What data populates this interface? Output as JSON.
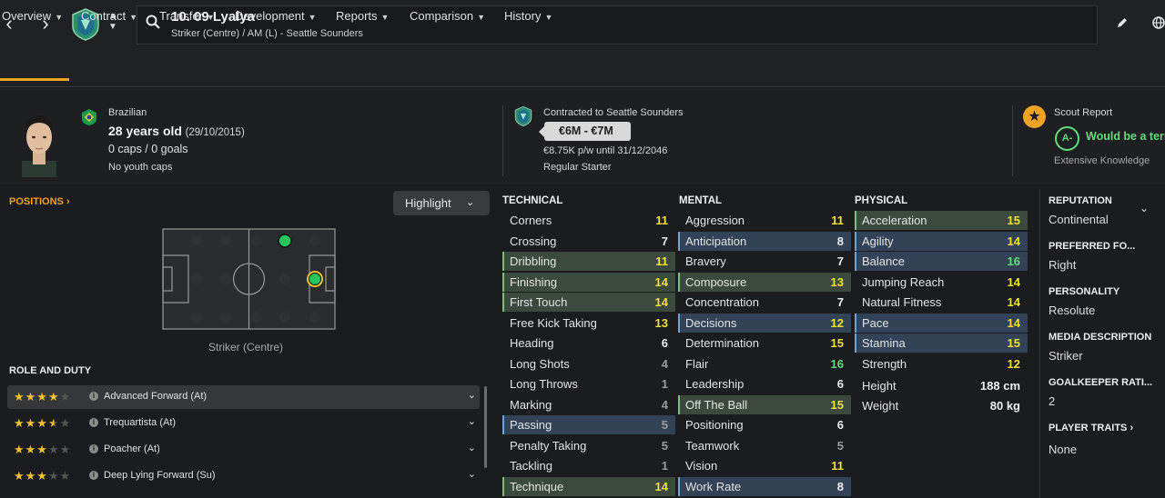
{
  "header": {
    "player_name": "10. 09 Lyalya",
    "player_subtitle": "Striker (Centre) / AM (L) - Seattle Sounders"
  },
  "tabs": [
    {
      "label": "Overview"
    },
    {
      "label": "Contract"
    },
    {
      "label": "Transfer"
    },
    {
      "label": "Development"
    },
    {
      "label": "Reports"
    },
    {
      "label": "Comparison"
    },
    {
      "label": "History"
    }
  ],
  "bio": {
    "nationality": "Brazilian",
    "age": "28 years old",
    "dob": "(29/10/2015)",
    "caps": "0 caps / 0 goals",
    "youth_caps": "No youth caps"
  },
  "contract": {
    "club_line": "Contracted to Seattle Sounders",
    "value": "€6M - €7M",
    "wage": "€8.75K p/w until 31/12/2046",
    "status": "Regular Starter"
  },
  "scout": {
    "title": "Scout Report",
    "grade": "A-",
    "summary": "Would be a terr",
    "knowledge": "Extensive Knowledge"
  },
  "positions": {
    "label": "POSITIONS",
    "highlight": "Highlight",
    "caption": "Striker (Centre)"
  },
  "roles": {
    "title": "ROLE AND DUTY",
    "items": [
      {
        "label": "Advanced Forward (At)",
        "stars": 4
      },
      {
        "label": "Trequartista (At)",
        "stars": 3.5
      },
      {
        "label": "Poacher (At)",
        "stars": 3
      },
      {
        "label": "Deep Lying Forward (Su)",
        "stars": 3
      }
    ]
  },
  "attributes": {
    "technical": {
      "title": "TECHNICAL",
      "items": [
        {
          "name": "Corners",
          "value": "11",
          "hl": "",
          "color": "yellow"
        },
        {
          "name": "Crossing",
          "value": "7",
          "hl": "",
          "color": "white"
        },
        {
          "name": "Dribbling",
          "value": "11",
          "hl": "green",
          "color": "yellow"
        },
        {
          "name": "Finishing",
          "value": "14",
          "hl": "green",
          "color": "yellow"
        },
        {
          "name": "First Touch",
          "value": "14",
          "hl": "green",
          "color": "yellow"
        },
        {
          "name": "Free Kick Taking",
          "value": "13",
          "hl": "",
          "color": "yellow"
        },
        {
          "name": "Heading",
          "value": "6",
          "hl": "",
          "color": "white"
        },
        {
          "name": "Long Shots",
          "value": "4",
          "hl": "",
          "color": "grey"
        },
        {
          "name": "Long Throws",
          "value": "1",
          "hl": "",
          "color": "grey"
        },
        {
          "name": "Marking",
          "value": "4",
          "hl": "",
          "color": "grey"
        },
        {
          "name": "Passing",
          "value": "5",
          "hl": "blue",
          "color": "grey"
        },
        {
          "name": "Penalty Taking",
          "value": "5",
          "hl": "",
          "color": "grey"
        },
        {
          "name": "Tackling",
          "value": "1",
          "hl": "",
          "color": "grey"
        },
        {
          "name": "Technique",
          "value": "14",
          "hl": "green",
          "color": "yellow"
        }
      ]
    },
    "mental": {
      "title": "MENTAL",
      "items": [
        {
          "name": "Aggression",
          "value": "11",
          "hl": "",
          "color": "yellow"
        },
        {
          "name": "Anticipation",
          "value": "8",
          "hl": "blue",
          "color": "white"
        },
        {
          "name": "Bravery",
          "value": "7",
          "hl": "",
          "color": "white"
        },
        {
          "name": "Composure",
          "value": "13",
          "hl": "green",
          "color": "yellow"
        },
        {
          "name": "Concentration",
          "value": "7",
          "hl": "",
          "color": "white"
        },
        {
          "name": "Decisions",
          "value": "12",
          "hl": "blue",
          "color": "yellow"
        },
        {
          "name": "Determination",
          "value": "15",
          "hl": "",
          "color": "yellow"
        },
        {
          "name": "Flair",
          "value": "16",
          "hl": "",
          "color": "green"
        },
        {
          "name": "Leadership",
          "value": "6",
          "hl": "",
          "color": "white"
        },
        {
          "name": "Off The Ball",
          "value": "15",
          "hl": "green",
          "color": "yellow"
        },
        {
          "name": "Positioning",
          "value": "6",
          "hl": "",
          "color": "white"
        },
        {
          "name": "Teamwork",
          "value": "5",
          "hl": "",
          "color": "grey"
        },
        {
          "name": "Vision",
          "value": "11",
          "hl": "",
          "color": "yellow"
        },
        {
          "name": "Work Rate",
          "value": "8",
          "hl": "blue",
          "color": "white"
        }
      ]
    },
    "physical": {
      "title": "PHYSICAL",
      "items": [
        {
          "name": "Acceleration",
          "value": "15",
          "hl": "green",
          "color": "yellow"
        },
        {
          "name": "Agility",
          "value": "14",
          "hl": "blue",
          "color": "yellow"
        },
        {
          "name": "Balance",
          "value": "16",
          "hl": "blue",
          "color": "green"
        },
        {
          "name": "Jumping Reach",
          "value": "14",
          "hl": "",
          "color": "yellow"
        },
        {
          "name": "Natural Fitness",
          "value": "14",
          "hl": "",
          "color": "yellow"
        },
        {
          "name": "Pace",
          "value": "14",
          "hl": "blue",
          "color": "yellow"
        },
        {
          "name": "Stamina",
          "value": "15",
          "hl": "blue",
          "color": "yellow"
        },
        {
          "name": "Strength",
          "value": "12",
          "hl": "",
          "color": "yellow"
        }
      ],
      "height_label": "Height",
      "height": "188 cm",
      "weight_label": "Weight",
      "weight": "80 kg"
    }
  },
  "sidebar": {
    "reputation_title": "REPUTATION",
    "reputation": "Continental",
    "foot_title": "PREFERRED FO...",
    "foot": "Right",
    "personality_title": "PERSONALITY",
    "personality": "Resolute",
    "media_title": "MEDIA DESCRIPTION",
    "media": "Striker",
    "gk_title": "GOALKEEPER RATI...",
    "gk": "2",
    "traits_title": "PLAYER TRAITS",
    "traits": "None"
  },
  "colors": {
    "accent": "#f0a323",
    "attr_yellow": "#f2e233",
    "attr_green": "#63dd7c",
    "hl_green": "#3c4a3e",
    "hl_blue": "#334357"
  }
}
